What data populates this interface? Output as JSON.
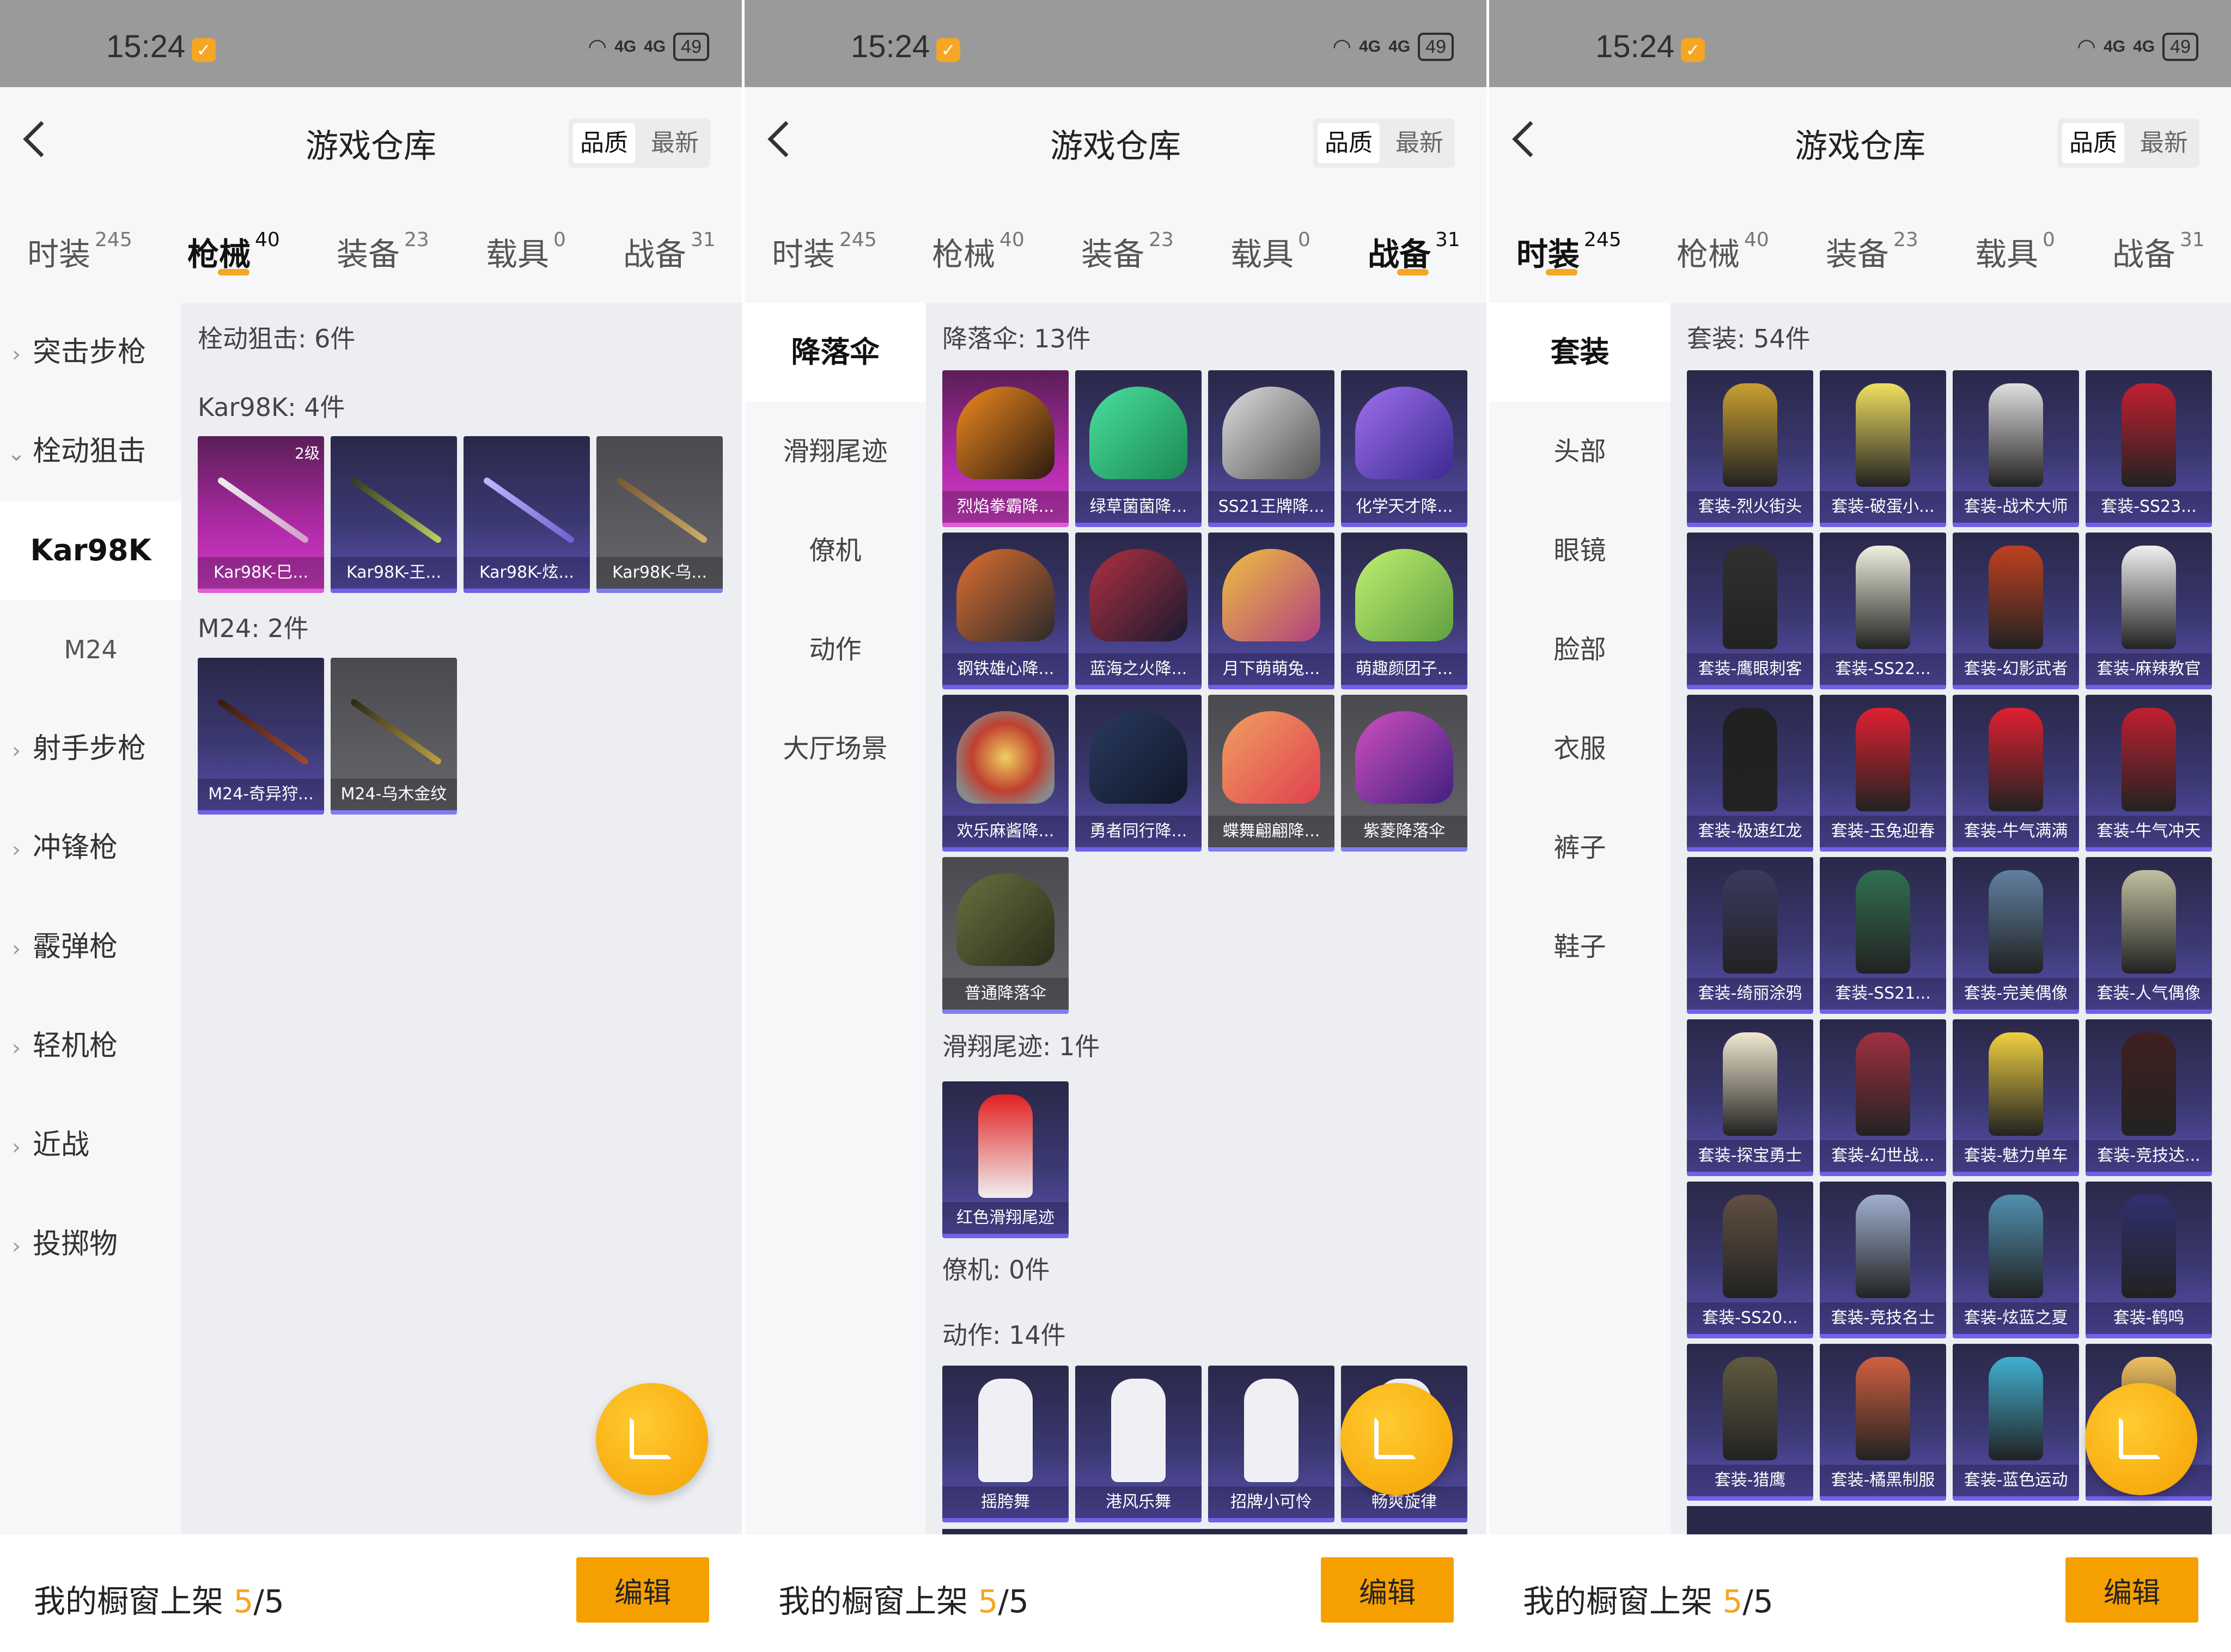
{
  "common": {
    "time": "15:24",
    "net1": "4G",
    "net2": "4G",
    "battery": "49",
    "title": "游戏仓库",
    "sort_quality": "品质",
    "sort_latest": "最新",
    "tabs": [
      {
        "label": "时装",
        "count": "245"
      },
      {
        "label": "枪械",
        "count": "40"
      },
      {
        "label": "装备",
        "count": "23"
      },
      {
        "label": "载具",
        "count": "0"
      },
      {
        "label": "战备",
        "count": "31"
      }
    ],
    "bottom_prefix": "我的橱窗上架 ",
    "bottom_current": "5",
    "bottom_total": "/5",
    "edit_label": "编辑",
    "accent": "#f5a623"
  },
  "panel1": {
    "active_tab": 1,
    "side": [
      "突击步枪",
      "栓动狙击",
      "Kar98K",
      "M24",
      "射手步枪",
      "冲锋枪",
      "霰弹枪",
      "轻机枪",
      "近战",
      "投掷物"
    ],
    "header": "栓动狙击: 6件",
    "groups": [
      {
        "label": "Kar98K: 4件",
        "items": [
          {
            "name": "Kar98K-巳...",
            "tag": "2级"
          },
          {
            "name": "Kar98K-王..."
          },
          {
            "name": "Kar98K-炫..."
          },
          {
            "name": "Kar98K-乌..."
          }
        ]
      },
      {
        "label": "M24: 2件",
        "items": [
          {
            "name": "M24-奇异狩..."
          },
          {
            "name": "M24-乌木金纹"
          }
        ]
      }
    ]
  },
  "panel2": {
    "active_tab": 4,
    "side": [
      "降落伞",
      "滑翔尾迹",
      "僚机",
      "动作",
      "大厅场景"
    ],
    "groups": [
      {
        "label": "降落伞: 13件",
        "items": [
          {
            "name": "烈焰拳霸降..."
          },
          {
            "name": "绿草菌菌降..."
          },
          {
            "name": "SS21王牌降..."
          },
          {
            "name": "化学天才降..."
          },
          {
            "name": "钢铁雄心降..."
          },
          {
            "name": "蓝海之火降..."
          },
          {
            "name": "月下萌萌兔..."
          },
          {
            "name": "萌趣颜团子..."
          },
          {
            "name": "欢乐麻酱降..."
          },
          {
            "name": "勇者同行降..."
          },
          {
            "name": "蝶舞翩翩降..."
          },
          {
            "name": "紫菱降落伞"
          },
          {
            "name": "普通降落伞"
          }
        ]
      },
      {
        "label": "滑翔尾迹: 1件",
        "items": [
          {
            "name": "红色滑翔尾迹"
          }
        ]
      },
      {
        "label": "僚机: 0件",
        "items": []
      },
      {
        "label": "动作: 14件",
        "items": [
          {
            "name": "摇胯舞"
          },
          {
            "name": "港风乐舞"
          },
          {
            "name": "招牌小可怜"
          },
          {
            "name": "畅爽旋律"
          }
        ]
      }
    ]
  },
  "panel3": {
    "active_tab": 0,
    "side": [
      "套装",
      "头部",
      "眼镜",
      "脸部",
      "衣服",
      "裤子",
      "鞋子"
    ],
    "header": "套装: 54件",
    "items": [
      {
        "name": "套装-烈火街头"
      },
      {
        "name": "套装-破蛋小..."
      },
      {
        "name": "套装-战术大师"
      },
      {
        "name": "套装-SS23..."
      },
      {
        "name": "套装-鹰眼刺客"
      },
      {
        "name": "套装-SS22..."
      },
      {
        "name": "套装-幻影武者"
      },
      {
        "name": "套装-麻辣教官"
      },
      {
        "name": "套装-极速红龙"
      },
      {
        "name": "套装-玉兔迎春"
      },
      {
        "name": "套装-牛气满满"
      },
      {
        "name": "套装-牛气冲天"
      },
      {
        "name": "套装-绮丽涂鸦"
      },
      {
        "name": "套装-SS21..."
      },
      {
        "name": "套装-完美偶像"
      },
      {
        "name": "套装-人气偶像"
      },
      {
        "name": "套装-探宝勇士"
      },
      {
        "name": "套装-幻世战..."
      },
      {
        "name": "套装-魅力单车"
      },
      {
        "name": "套装-竞技达..."
      },
      {
        "name": "套装-SS20..."
      },
      {
        "name": "套装-竞技名士"
      },
      {
        "name": "套装-炫蓝之夏"
      },
      {
        "name": "套装-鹤鸣"
      },
      {
        "name": "套装-猎鹰"
      },
      {
        "name": "套装-橘黑制服"
      },
      {
        "name": "套装-蓝色运动"
      },
      {
        "name": ""
      }
    ]
  }
}
